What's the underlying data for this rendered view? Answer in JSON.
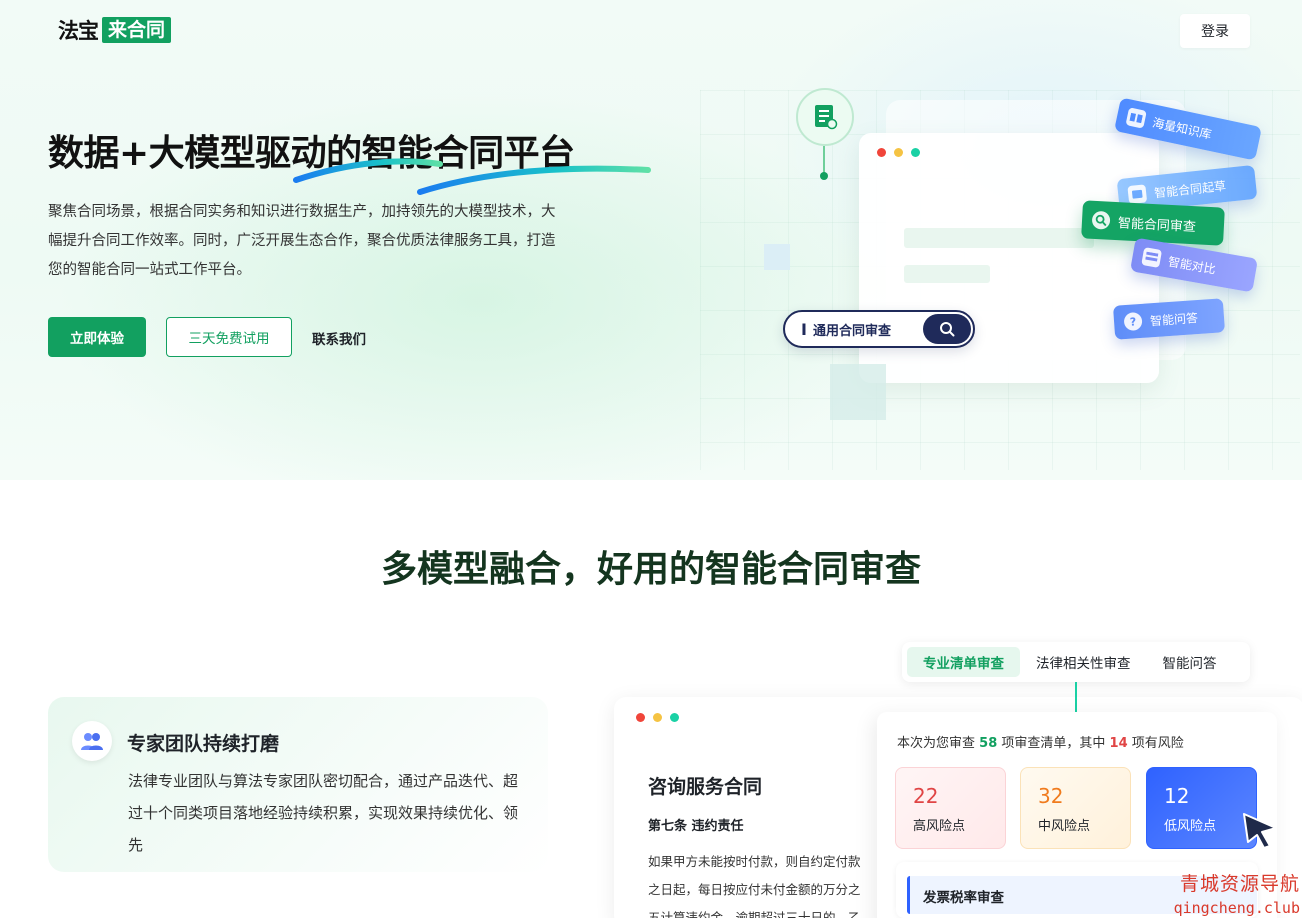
{
  "nav": {
    "logo_left": "法宝",
    "logo_right": "来合同",
    "login_label": "登录"
  },
  "hero": {
    "title": "数据+大模型驱动的智能合同平台",
    "description": "聚焦合同场景，根据合同实务和知识进行数据生产，加持领先的大模型技术，大幅提升合同工作效率。同时，广泛开展生态合作，聚合优质法律服务工具，打造您的智能合同一站式工作平台。",
    "primary_button": "立即体验",
    "secondary_button": "三天免费试用",
    "link_button": "联系我们",
    "search_text": "通用合同审查",
    "tags": [
      "海量知识库",
      "智能合同起草",
      "智能合同审查",
      "智能对比",
      "智能问答"
    ]
  },
  "section": {
    "title": "多模型融合，好用的智能合同审查",
    "feature": {
      "title": "专家团队持续打磨",
      "description": "法律专业团队与算法专家团队密切配合，通过产品迭代、超过十个同类项目落地经验持续积累，实现效果持续优化、领先"
    },
    "tabs": [
      "专业清单审查",
      "法律相关性审查",
      "智能问答"
    ],
    "active_tab": "专业清单审查",
    "document": {
      "title": "咨询服务合同",
      "clause": "第七条 违约责任",
      "lines": [
        "如果甲方未能按时付款，则自约定付款",
        "之日起，每日按应付未付金额的万分之",
        "五计算违约金，逾期超过三十日的，乙"
      ]
    },
    "review": {
      "summary_prefix": "本次为您审查",
      "total": "58",
      "summary_mid": "项审查清单，其中",
      "risk_count": "14",
      "summary_suffix": "项有风险",
      "high": {
        "value": "22",
        "label": "高风险点"
      },
      "mid": {
        "value": "32",
        "label": "中风险点"
      },
      "low": {
        "value": "12",
        "label": "低风险点"
      },
      "invoice_label": "发票税率审查"
    }
  },
  "watermark": {
    "line1": "青城资源导航",
    "line2": "qingcheng.club"
  },
  "colors": {
    "brand_green": "#12a060",
    "risk_high": "#e04545",
    "risk_mid": "#f07b1d",
    "risk_low": "#2f62ff"
  }
}
